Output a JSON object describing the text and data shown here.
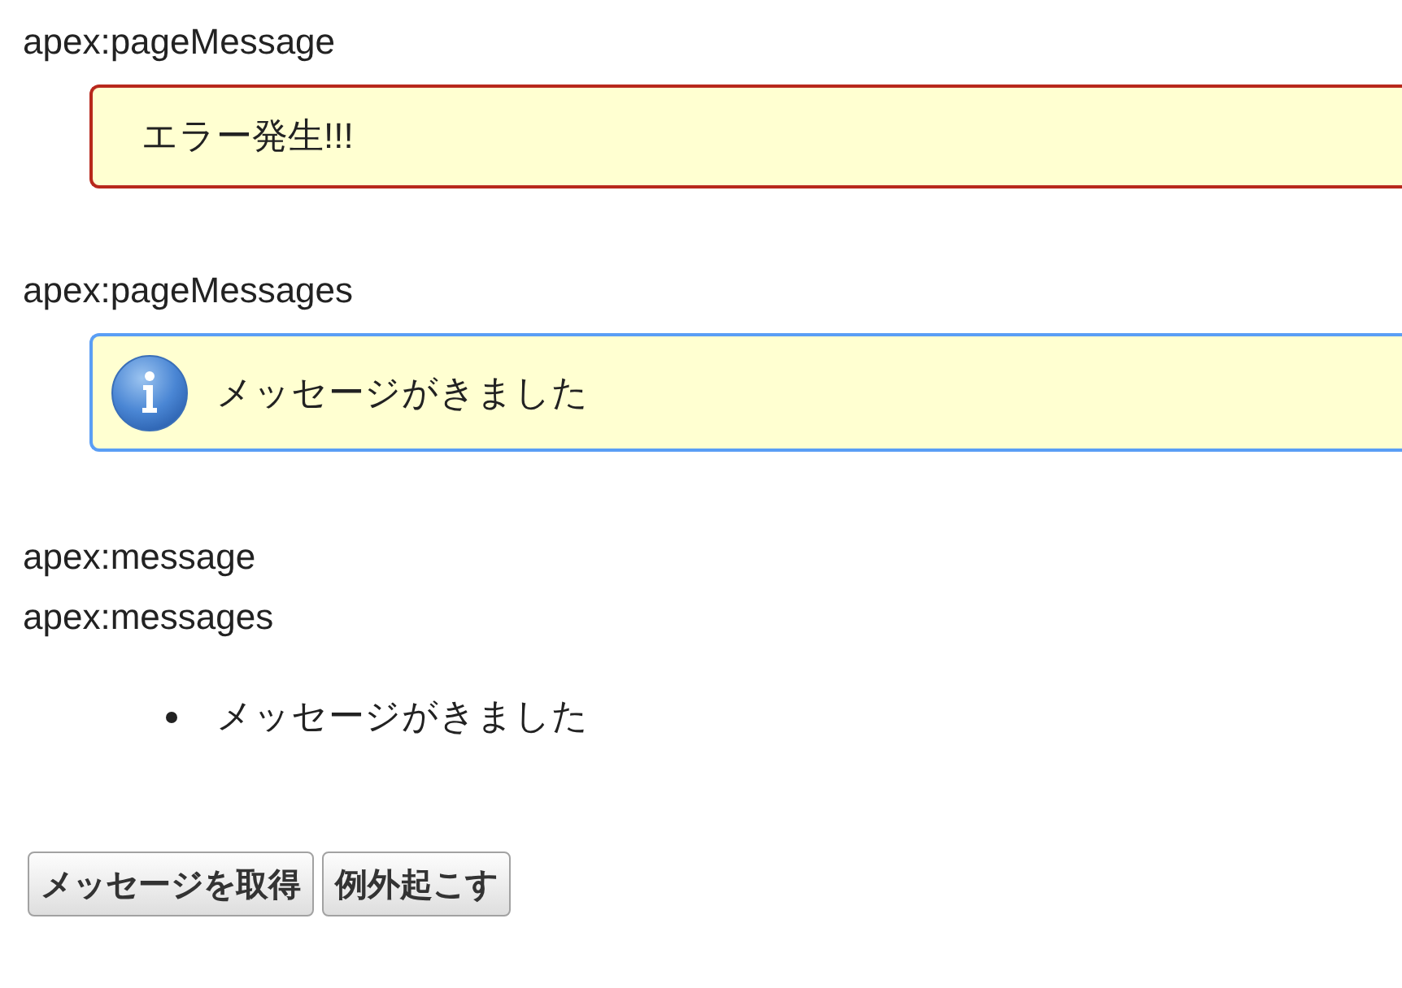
{
  "sections": [
    {
      "heading": "apex:pageMessage",
      "box": {
        "kind": "error",
        "text": "エラー発生!!!"
      }
    },
    {
      "heading": "apex:pageMessages",
      "box": {
        "kind": "info",
        "text": "メッセージがきました"
      }
    },
    {
      "heading": "apex:message"
    },
    {
      "heading": "apex:messages",
      "items": [
        "メッセージがきました"
      ]
    }
  ],
  "buttons": [
    "メッセージを取得",
    "例外起こす"
  ]
}
